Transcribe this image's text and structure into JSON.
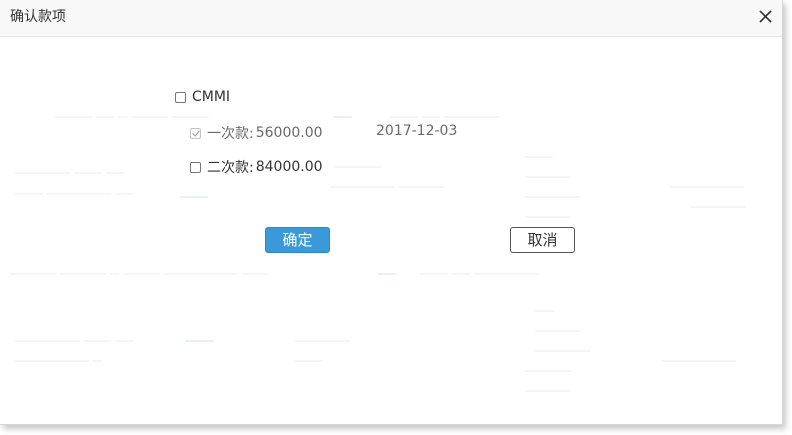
{
  "dialog": {
    "title": "确认款项",
    "close_icon": "close-icon"
  },
  "items": {
    "group": {
      "label": "CMMI",
      "checked": false
    },
    "installments": [
      {
        "label": "一次款:",
        "amount": "56000.00",
        "date": "2017-12-03",
        "checked": true,
        "disabled": true
      },
      {
        "label": "二次款:",
        "amount": "84000.00",
        "checked": false,
        "disabled": false
      }
    ]
  },
  "buttons": {
    "confirm_label": "确定",
    "cancel_label": "取消"
  },
  "colors": {
    "primary": "#3a9ad9",
    "header_bg": "#f8f8f8",
    "text": "#333333",
    "muted_text": "#6a6a6a"
  }
}
